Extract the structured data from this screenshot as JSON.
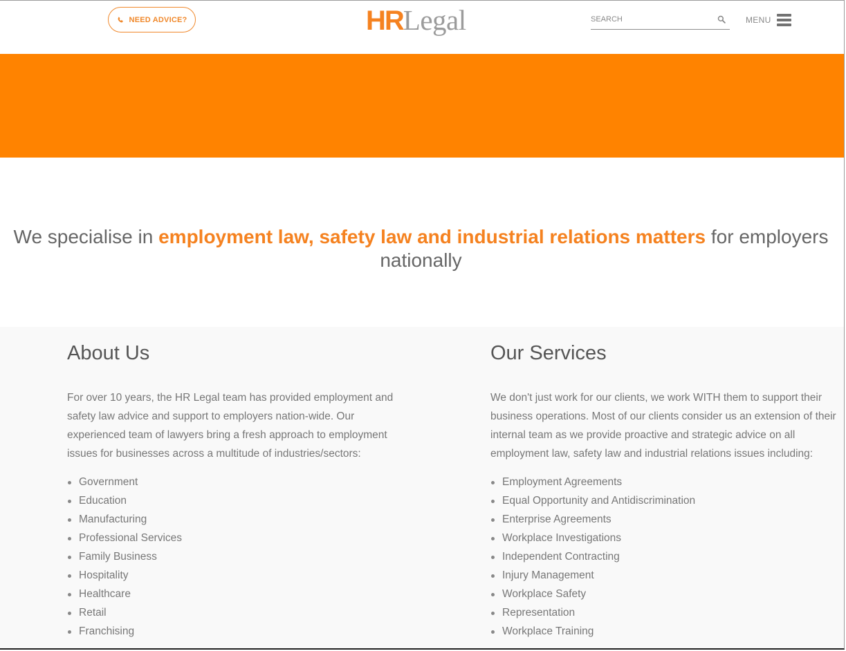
{
  "header": {
    "advice_label": "NEED ADVICE?",
    "logo_hr": "HR",
    "logo_legal": "Legal",
    "search_placeholder": "SEARCH",
    "menu_label": "MENU"
  },
  "colors": {
    "accent": "#f58220",
    "banner": "#ff8300",
    "text": "#666666",
    "content_bg": "#f9f9f9"
  },
  "icons": {
    "advice": "phone-icon",
    "search": "search-icon",
    "menu": "hamburger-icon"
  },
  "intro": {
    "prefix": "We specialise in ",
    "highlight": "employment law, safety law and industrial relations matters",
    "suffix": " for employers nationally"
  },
  "about": {
    "title": "About Us",
    "text": "For over 10 years, the HR Legal team has provided employment and safety law advice and support to employers nation-wide. Our experienced team of lawyers bring a fresh approach to employment issues for businesses across a multitude of industries/sectors:",
    "items": [
      "Government",
      "Education",
      "Manufacturing",
      "Professional Services",
      "Family Business",
      "Hospitality",
      "Healthcare",
      "Retail",
      "Franchising"
    ]
  },
  "services": {
    "title": "Our Services",
    "text": "We don't just work for our clients, we work WITH them to support their business operations. Most of our clients consider us an extension of their internal team as we provide proactive and strategic advice on all employment law, safety law and industrial relations issues including:",
    "items": [
      "Employment Agreements",
      "Equal Opportunity and Antidiscrimination",
      "Enterprise Agreements",
      "Workplace Investigations",
      "Independent Contracting",
      "Injury Management",
      "Workplace Safety",
      "Representation",
      "Workplace Training"
    ]
  }
}
